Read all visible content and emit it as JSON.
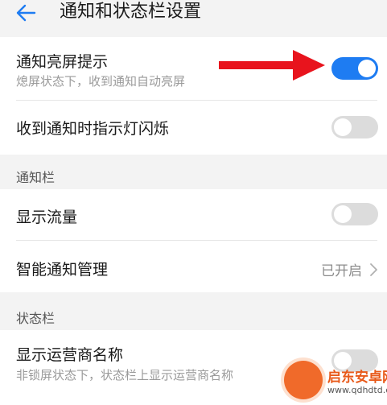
{
  "header": {
    "title": "通知和状态栏设置"
  },
  "items": [
    {
      "title": "通知亮屏提示",
      "subtitle": "熄屏状态下，收到通知自动亮屏",
      "toggle": "on"
    },
    {
      "title": "收到通知时指示灯闪烁",
      "toggle": "off"
    }
  ],
  "sections": [
    {
      "label": "通知栏",
      "items": [
        {
          "title": "显示流量",
          "toggle": "off"
        },
        {
          "title": "智能通知管理",
          "value": "已开启"
        }
      ]
    },
    {
      "label": "状态栏",
      "items": [
        {
          "title": "显示运营商名称",
          "subtitle": "非锁屏状态下，状态栏上显示运营商名称",
          "toggle": "off"
        }
      ]
    }
  ],
  "watermark": {
    "name": "启东安卓网",
    "url": "www.qdhdtd.com"
  },
  "colors": {
    "accent": "#1e7cf2",
    "annotation_arrow": "#e8141d",
    "background": "#f3f3f3"
  }
}
